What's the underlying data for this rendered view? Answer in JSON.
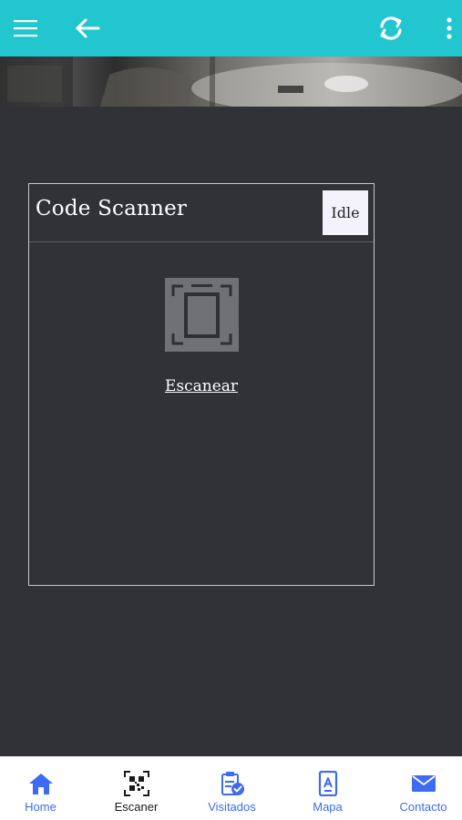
{
  "colors": {
    "toolbar": "#21c6cf",
    "background": "#303236",
    "nav_accent": "#3d6bf2",
    "nav_active_text": "#1a1a1a"
  },
  "toolbar": {
    "menu_icon": "hamburger-menu-icon",
    "back_icon": "arrow-left-icon",
    "refresh_icon": "refresh-icon",
    "more_icon": "vertical-dots-icon"
  },
  "scanner": {
    "title": "Code Scanner",
    "status": "Idle",
    "scan_icon": "document-scan-icon",
    "scan_label": "Escanear"
  },
  "bottom_nav": {
    "items": [
      {
        "label": "Home",
        "icon": "house-icon",
        "active": false
      },
      {
        "label": "Escaner",
        "icon": "qr-code-icon",
        "active": true
      },
      {
        "label": "Visitados",
        "icon": "clipboard-check-icon",
        "active": false
      },
      {
        "label": "Mapa",
        "icon": "map-document-icon",
        "active": false
      },
      {
        "label": "Contacto",
        "icon": "envelope-icon",
        "active": false
      }
    ]
  }
}
